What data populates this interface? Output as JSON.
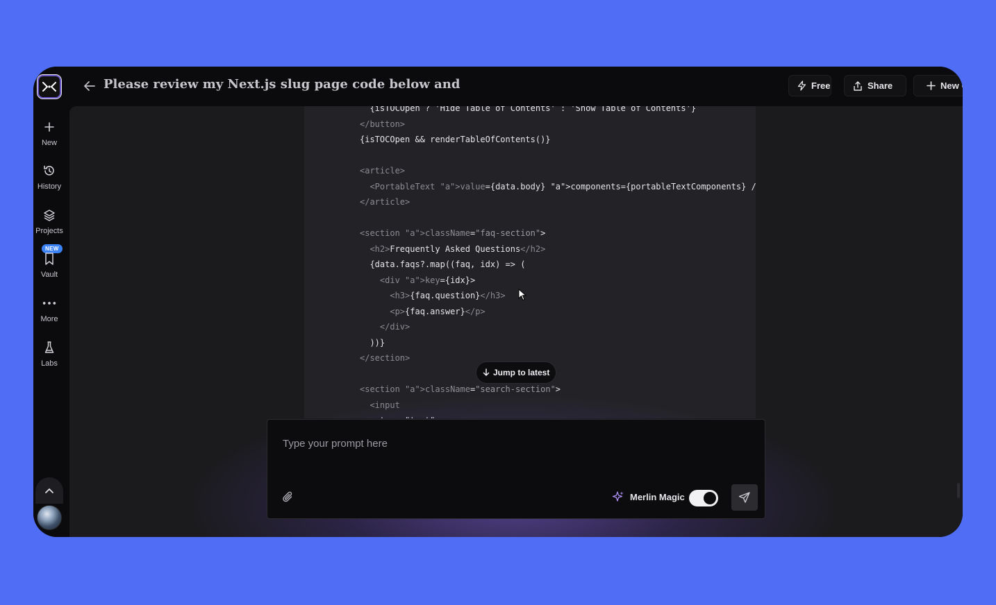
{
  "sidebar": {
    "items": [
      {
        "label": "New",
        "icon": "plus-icon"
      },
      {
        "label": "History",
        "icon": "history-icon"
      },
      {
        "label": "Projects",
        "icon": "layers-icon"
      },
      {
        "label": "Vault",
        "icon": "bookmark-icon",
        "badge": "NEW"
      },
      {
        "label": "More",
        "icon": "more-dots-icon"
      },
      {
        "label": "Labs",
        "icon": "flask-icon"
      }
    ]
  },
  "header": {
    "title": "Please review my Next.js slug page code below and",
    "free_label": "Free",
    "share_label": "Share",
    "new_chat_label": "New Chat"
  },
  "code": {
    "lines": [
      "  {isTOCOpen ? 'Hide Table of Contents' : 'Show Table of Contents'}",
      "</button>",
      "{isTOCOpen && renderTableOfContents()}",
      "",
      "<article>",
      "  <PortableText value={data.body} components={portableTextComponents} />",
      "</article>",
      "",
      "<section className=\"faq-section\">",
      "  <h2>Frequently Asked Questions</h2>",
      "  {data.faqs?.map((faq, idx) => (",
      "    <div key={idx}>",
      "      <h3>{faq.question}</h3>",
      "      <p>{faq.answer}</p>",
      "    </div>",
      "  ))}",
      "</section>",
      "",
      "<section className=\"search-section\">",
      "  <input",
      "    type=\"text\""
    ]
  },
  "jump_label": "Jump to latest",
  "prompt": {
    "placeholder": "Type your prompt here",
    "value": "",
    "magic_label": "Merlin Magic",
    "magic_enabled": true
  },
  "colors": {
    "background": "#4f6ef5",
    "app": "#0b0b0d",
    "panel": "#1b1b1e",
    "accent_badge": "#3b82f6",
    "glow": "#7a5cdc"
  }
}
